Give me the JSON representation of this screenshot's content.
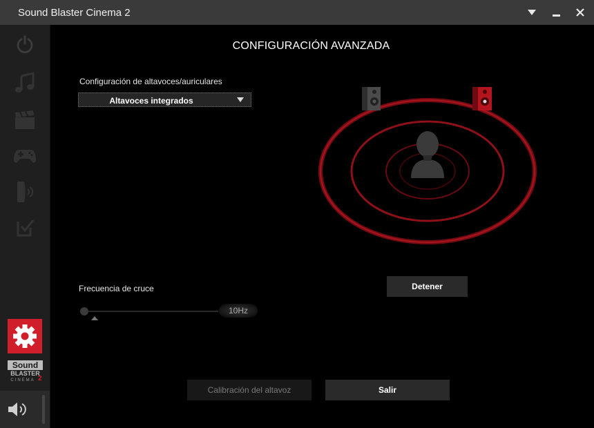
{
  "window": {
    "title": "Sound Blaster Cinema 2"
  },
  "sidebar": {
    "items": [
      {
        "icon": "power-icon"
      },
      {
        "icon": "music-icon"
      },
      {
        "icon": "movie-clapper-icon"
      },
      {
        "icon": "gamepad-icon"
      },
      {
        "icon": "voice-icon"
      },
      {
        "icon": "checklist-icon"
      }
    ],
    "settings_icon": "gear-icon",
    "logo": {
      "line1": "Sound",
      "line2": "BLASTER",
      "line3": "CINEMA",
      "line4": "2"
    },
    "volume_icon": "speaker-volume-icon"
  },
  "main": {
    "title": "CONFIGURACIÓN AVANZADA",
    "speaker_config_label": "Configuración de altavoces/auriculares",
    "speaker_config_value": "Altavoces integrados",
    "crossover_label": "Frecuencia de cruce",
    "crossover_value": "10Hz",
    "stop_button": "Detener",
    "calibrate_button": "Calibración del altavoz",
    "exit_button": "Salir"
  },
  "colors": {
    "accent": "#d01f2a",
    "titlebar": "#3a3a3a",
    "sidebar": "#1f1f1f"
  }
}
